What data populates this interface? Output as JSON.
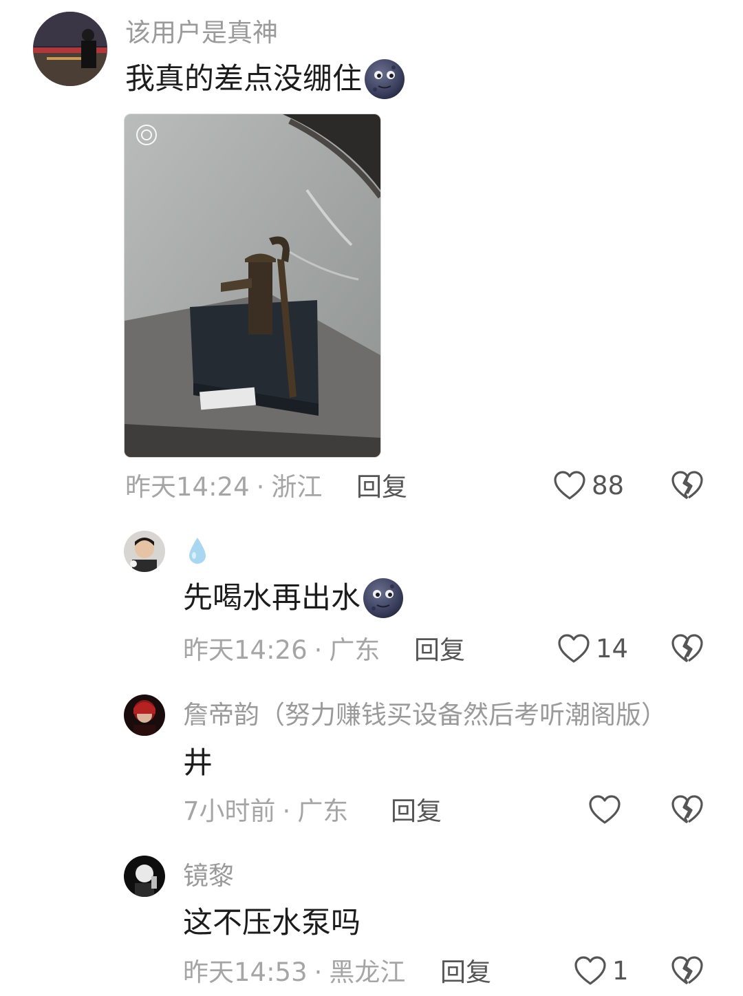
{
  "comments": [
    {
      "username": "该用户是真神",
      "text": "我真的差点没绷住",
      "time": "昨天14:24",
      "dot": "·",
      "location": "浙江",
      "reply_label": "回复",
      "likes": "88"
    },
    {
      "username": "",
      "text": "先喝水再出水",
      "time": "昨天14:26",
      "dot": "·",
      "location": "广东",
      "reply_label": "回复",
      "likes": "14"
    },
    {
      "username": "詹帝韵（努力赚钱买设备然后考听潮阁版）",
      "text": "井",
      "time": "7小时前",
      "dot": "·",
      "location": "广东",
      "reply_label": "回复",
      "likes": ""
    },
    {
      "username": "镜黎",
      "text": "这不压水泵吗",
      "time": "昨天14:53",
      "dot": "·",
      "location": "黑龙江",
      "reply_label": "回复",
      "likes": "1"
    }
  ],
  "icons": {
    "like": "heart-outline-icon",
    "dislike": "broken-heart-icon",
    "emoji": "new-moon-face-emoji",
    "username_emoji": "droplet-emoji"
  },
  "colors": {
    "username": "#9a9a9a",
    "meta": "#a5a5a5",
    "action": "#555555",
    "text": "#1c1c1c"
  }
}
